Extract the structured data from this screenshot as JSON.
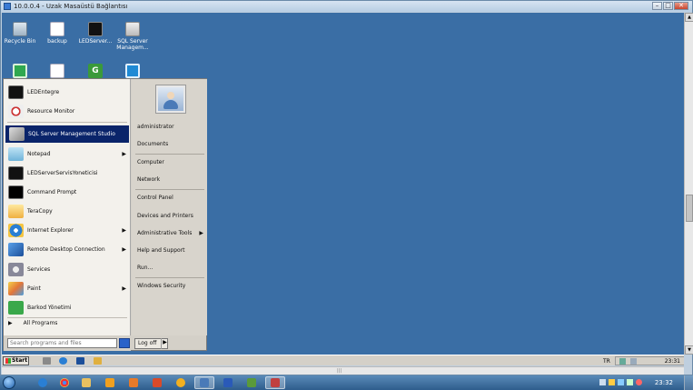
{
  "window": {
    "title": "10.0.0.4 - Uzak Masaüstü Bağlantısı"
  },
  "desktop": {
    "icons": [
      {
        "label": "Recycle Bin",
        "icon": "recycle-bin-icon"
      },
      {
        "label": "backup",
        "icon": "document-icon"
      },
      {
        "label": "LEDServer...",
        "icon": "led-icon"
      },
      {
        "label": "SQL Server Managem...",
        "icon": "sql-server-icon"
      },
      {
        "label": "",
        "icon": "green-app-icon"
      },
      {
        "label": "",
        "icon": "document-icon"
      },
      {
        "label": "",
        "icon": "g-app-icon"
      },
      {
        "label": "",
        "icon": "teamviewer-icon"
      }
    ]
  },
  "start_menu": {
    "programs": [
      {
        "label": "LEDEntegre",
        "icon": "led-icon",
        "submenu": false
      },
      {
        "label": "Resource Monitor",
        "icon": "resource-monitor-icon",
        "submenu": false
      },
      {
        "label": "SQL Server Management Studio",
        "icon": "sql-server-icon",
        "submenu": false,
        "selected": true
      },
      {
        "label": "Notepad",
        "icon": "notepad-icon",
        "submenu": true
      },
      {
        "label": "LEDServerServisYoneticisi",
        "icon": "led-icon",
        "submenu": false
      },
      {
        "label": "Command Prompt",
        "icon": "command-prompt-icon",
        "submenu": false
      },
      {
        "label": "TeraCopy",
        "icon": "teracopy-icon",
        "submenu": false
      },
      {
        "label": "Internet Explorer",
        "icon": "internet-explorer-icon",
        "submenu": true
      },
      {
        "label": "Remote Desktop Connection",
        "icon": "remote-desktop-icon",
        "submenu": true
      },
      {
        "label": "Services",
        "icon": "services-icon",
        "submenu": false
      },
      {
        "label": "Paint",
        "icon": "paint-icon",
        "submenu": true
      },
      {
        "label": "Barkod Yönetimi",
        "icon": "barkod-icon",
        "submenu": false
      }
    ],
    "all_programs": "All Programs",
    "search_placeholder": "Search programs and files",
    "right_items": [
      {
        "label": "administrator",
        "submenu": false
      },
      {
        "label": "Documents",
        "submenu": false
      },
      {
        "label": "Computer",
        "submenu": false
      },
      {
        "label": "Network",
        "submenu": false
      },
      {
        "label": "Control Panel",
        "submenu": false
      },
      {
        "label": "Devices and Printers",
        "submenu": false
      },
      {
        "label": "Administrative Tools",
        "submenu": true
      },
      {
        "label": "Help and Support",
        "submenu": false
      },
      {
        "label": "Run...",
        "submenu": false
      },
      {
        "label": "Windows Security",
        "submenu": false
      }
    ],
    "logoff_label": "Log off"
  },
  "remote_taskbar": {
    "start_label": "Start",
    "language": "TR",
    "time": "23:31"
  },
  "local_taskbar": {
    "time": "23:32"
  },
  "colors": {
    "remote_desktop_bg": "#3a6ea5",
    "selection": "#0a246a",
    "local_taskbar": "#2e5d8c"
  }
}
